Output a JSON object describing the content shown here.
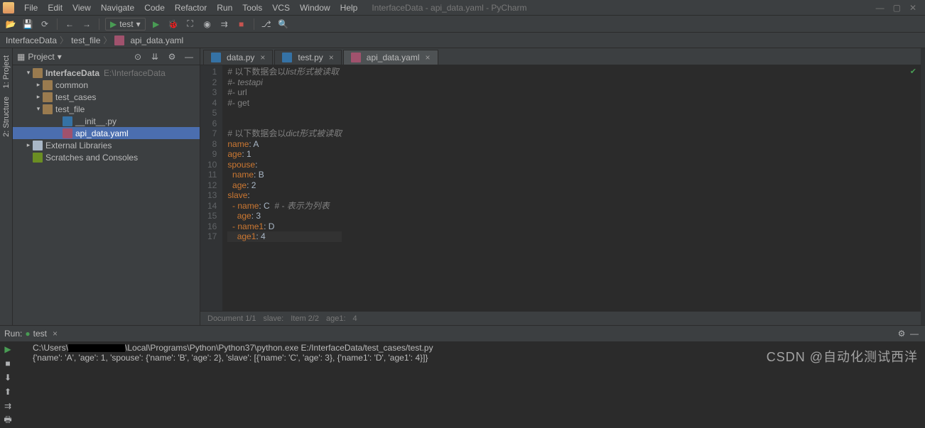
{
  "menu": [
    "File",
    "Edit",
    "View",
    "Navigate",
    "Code",
    "Refactor",
    "Run",
    "Tools",
    "VCS",
    "Window",
    "Help"
  ],
  "window_title": "InterfaceData - api_data.yaml - PyCharm",
  "toolbar": {
    "run_config": "test"
  },
  "breadcrumb": [
    "InterfaceData",
    "test_file",
    "api_data.yaml"
  ],
  "sidebar_tabs": [
    "1: Project",
    "2: Structure"
  ],
  "project_panel": {
    "title": "Project",
    "tree": {
      "root": {
        "name": "InterfaceData",
        "hint": "E:\\InterfaceData"
      },
      "common": "common",
      "test_cases": "test_cases",
      "test_file": "test_file",
      "init_py": "__init__.py",
      "api_data": "api_data.yaml",
      "ext_lib": "External Libraries",
      "scratches": "Scratches and Consoles"
    }
  },
  "tabs": [
    {
      "icon": "py",
      "label": "data.py",
      "active": false
    },
    {
      "icon": "py",
      "label": "test.py",
      "active": false
    },
    {
      "icon": "yaml",
      "label": "api_data.yaml",
      "active": true
    }
  ],
  "code_lines": [
    {
      "n": 1,
      "segs": [
        {
          "t": "# 以下数据会以",
          "c": "c-comment"
        },
        {
          "t": "list",
          "c": "c-italic"
        },
        {
          "t": "形式被读取",
          "c": "c-cn"
        }
      ]
    },
    {
      "n": 2,
      "segs": [
        {
          "t": "#- ",
          "c": "c-comment"
        },
        {
          "t": "testapi",
          "c": "c-italic"
        }
      ]
    },
    {
      "n": 3,
      "segs": [
        {
          "t": "#- url",
          "c": "c-comment"
        }
      ]
    },
    {
      "n": 4,
      "segs": [
        {
          "t": "#- get",
          "c": "c-comment"
        }
      ]
    },
    {
      "n": 5,
      "segs": []
    },
    {
      "n": 6,
      "segs": []
    },
    {
      "n": 7,
      "segs": [
        {
          "t": "# 以下数据会以",
          "c": "c-comment"
        },
        {
          "t": "dict",
          "c": "c-italic"
        },
        {
          "t": "形式被读取",
          "c": "c-cn"
        }
      ]
    },
    {
      "n": 8,
      "segs": [
        {
          "t": "name",
          "c": "c-key"
        },
        {
          "t": ": A",
          "c": "c-val"
        }
      ]
    },
    {
      "n": 9,
      "segs": [
        {
          "t": "age",
          "c": "c-key"
        },
        {
          "t": ": 1",
          "c": "c-val"
        }
      ]
    },
    {
      "n": 10,
      "segs": [
        {
          "t": "spouse",
          "c": "c-key"
        },
        {
          "t": ":",
          "c": "c-val"
        }
      ]
    },
    {
      "n": 11,
      "segs": [
        {
          "t": "  name",
          "c": "c-key"
        },
        {
          "t": ": B",
          "c": "c-val"
        }
      ]
    },
    {
      "n": 12,
      "segs": [
        {
          "t": "  age",
          "c": "c-key"
        },
        {
          "t": ": 2",
          "c": "c-val"
        }
      ]
    },
    {
      "n": 13,
      "segs": [
        {
          "t": "slave",
          "c": "c-key"
        },
        {
          "t": ":",
          "c": "c-val"
        }
      ]
    },
    {
      "n": 14,
      "segs": [
        {
          "t": "  - name",
          "c": "c-key"
        },
        {
          "t": ": C  ",
          "c": "c-val"
        },
        {
          "t": "# - 表示为列表",
          "c": "c-cn"
        }
      ]
    },
    {
      "n": 15,
      "segs": [
        {
          "t": "    age",
          "c": "c-key"
        },
        {
          "t": ": 3",
          "c": "c-val"
        }
      ]
    },
    {
      "n": 16,
      "segs": [
        {
          "t": "  - name1",
          "c": "c-key"
        },
        {
          "t": ": D",
          "c": "c-val"
        }
      ]
    },
    {
      "n": 17,
      "segs": [
        {
          "t": "    age1",
          "c": "c-key"
        },
        {
          "t": ": 4",
          "c": "c-val"
        }
      ],
      "hl": true
    }
  ],
  "status": {
    "doc": "Document 1/1",
    "slave": "slave:",
    "item": "Item 2/2",
    "age1": "age1:",
    "last": "4"
  },
  "run": {
    "label": "Run:",
    "config": "test",
    "line1_a": "C:\\Users\\",
    "line1_b": "\\Local\\Programs\\Python\\Python37\\python.exe E:/InterfaceData/test_cases/test.py",
    "line2": "{'name': 'A', 'age': 1, 'spouse': {'name': 'B', 'age': 2}, 'slave': [{'name': 'C', 'age': 3}, {'name1': 'D', 'age1': 4}]}"
  },
  "watermark": "CSDN @自动化测试西洋"
}
